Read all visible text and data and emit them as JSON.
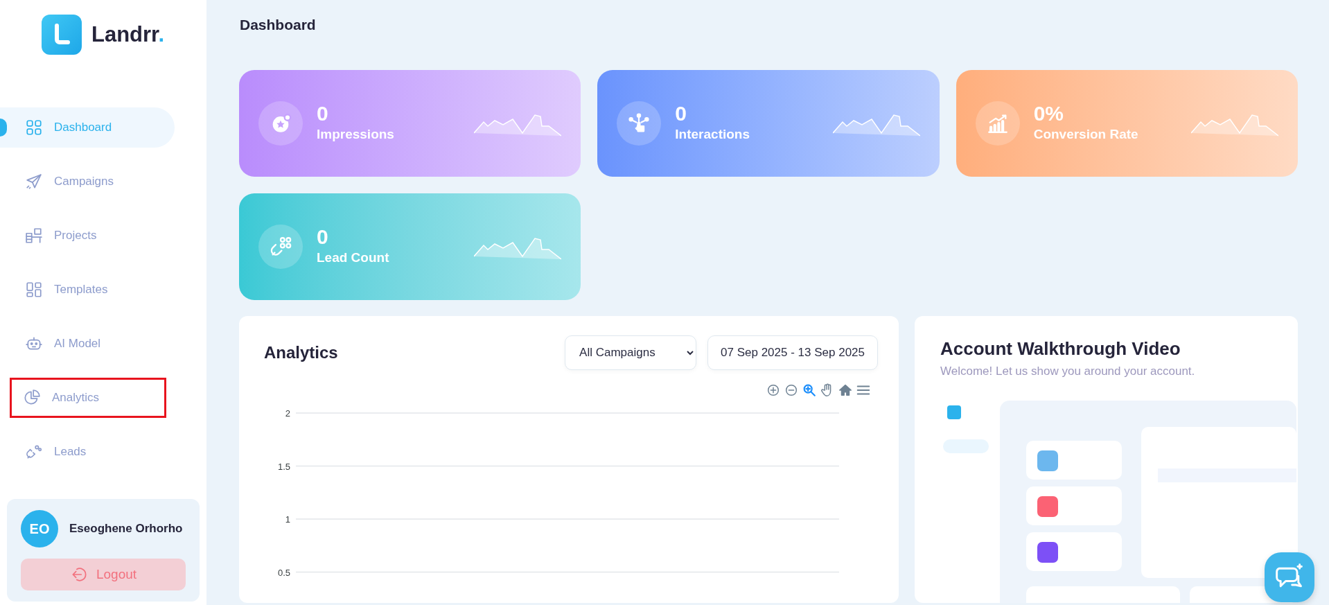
{
  "brand": {
    "name": "Landrr",
    "dot": "."
  },
  "sidebar": {
    "items": [
      {
        "label": "Dashboard",
        "kind": "dashboard",
        "selected": true,
        "highlighted": false
      },
      {
        "label": "Campaigns",
        "kind": "campaigns",
        "selected": false,
        "highlighted": false
      },
      {
        "label": "Projects",
        "kind": "projects",
        "selected": false,
        "highlighted": false
      },
      {
        "label": "Templates",
        "kind": "templates",
        "selected": false,
        "highlighted": false
      },
      {
        "label": "AI Model",
        "kind": "ai",
        "selected": false,
        "highlighted": false
      },
      {
        "label": "Analytics",
        "kind": "analytics",
        "selected": false,
        "highlighted": true
      },
      {
        "label": "Leads",
        "kind": "leads",
        "selected": false,
        "highlighted": false
      }
    ]
  },
  "user": {
    "initials": "EO",
    "name": "Eseoghene Orhorho",
    "logout": "Logout"
  },
  "page_title": "Dashboard",
  "stats": [
    {
      "value": "0",
      "label": "Impressions",
      "kind": "impressions",
      "color": "#b98cfc"
    },
    {
      "value": "0",
      "label": "Interactions",
      "kind": "interactions",
      "color": "#6a93fd"
    },
    {
      "value": "0%",
      "label": "Conversion Rate",
      "kind": "conversion",
      "color": "#ffae7c"
    },
    {
      "value": "0",
      "label": "Lead Count",
      "kind": "leads",
      "color": "#3ac9d5"
    }
  ],
  "analytics": {
    "title": "Analytics",
    "campaign_select": "All Campaigns",
    "date_range": "07 Sep 2025 - 13 Sep 2025",
    "chart_tools": [
      {
        "kind": "zoom-in",
        "selected": false
      },
      {
        "kind": "zoom-out",
        "selected": false
      },
      {
        "kind": "zoom",
        "selected": true
      },
      {
        "kind": "pan",
        "selected": false
      },
      {
        "kind": "home",
        "selected": false
      },
      {
        "kind": "menu",
        "selected": false
      }
    ],
    "chart_data": {
      "type": "line",
      "categories": [
        null,
        null,
        null,
        null,
        null,
        null,
        null
      ],
      "grid": true,
      "ylim": [
        0.5,
        2
      ],
      "yticks": [
        {
          "value": 0.5,
          "label": "0.5"
        },
        {
          "value": 1,
          "label": "1"
        },
        {
          "value": 1.5,
          "label": "1.5"
        },
        {
          "value": 2,
          "label": "2"
        }
      ]
    }
  },
  "walkthrough": {
    "title": "Account Walkthrough Video",
    "subtitle": "Welcome! Let us show you around your account."
  }
}
